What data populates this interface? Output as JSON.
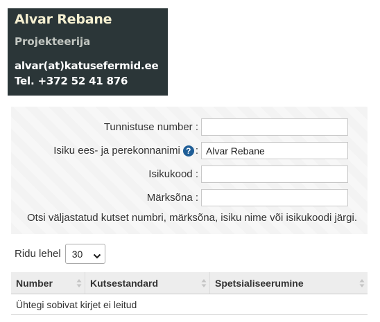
{
  "contact_card": {
    "name": "Alvar Rebane",
    "role": "Projekteerija",
    "email": "alvar(at)katusefermid.ee",
    "phone": "Tel. +372 52 41 876"
  },
  "search": {
    "fields": [
      {
        "label": "Tunnistuse number :",
        "value": ""
      },
      {
        "label": "Isiku ees- ja perekonnanimi",
        "suffix": ":",
        "value": "Alvar Rebane",
        "help": "?"
      },
      {
        "label": "Isikukood :",
        "value": ""
      },
      {
        "label": "Märksõna :",
        "value": ""
      }
    ],
    "hint": "Otsi väljastatud kutset numbri, märksõna, isiku nime või isikukoodi järgi."
  },
  "pagination": {
    "rows_label": "Ridu lehel",
    "rows_value": "30"
  },
  "results_table": {
    "columns": [
      "Number",
      "Kutsestandard",
      "Spetsialiseerumine"
    ],
    "empty_message": "Ühtegi sobivat kirjet ei leitud"
  },
  "colors": {
    "card_background": "#2b3638",
    "card_name": "#f4efd0",
    "help_icon": "#1f5e97"
  }
}
